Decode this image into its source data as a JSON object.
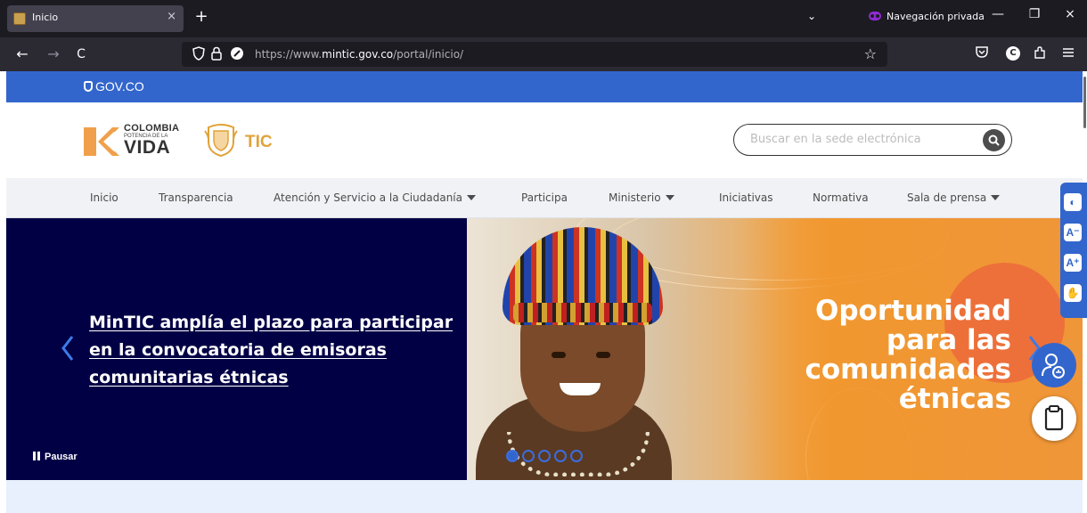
{
  "browser": {
    "tab_title": "Inicio",
    "tab_close": "×",
    "new_tab": "+",
    "list_tabs": "⌄",
    "private_label": "Navegación privada",
    "win_min": "—",
    "win_restore": "❐",
    "win_close": "×",
    "back": "←",
    "forward": "→",
    "reload": "C",
    "url_prefix": "https://www.",
    "url_domain": "mintic.gov.co",
    "url_path": "/portal/inicio/",
    "star": "☆",
    "profile_initial": "C"
  },
  "gov_bar": {
    "logo_text": "GOV.CO"
  },
  "header": {
    "brand_line1": "COLOMBIA",
    "brand_line2": "POTENCIA DE LA",
    "brand_line3": "VIDA",
    "tic_text": "TIC",
    "search_placeholder": "Buscar en la sede electrónica"
  },
  "menu": {
    "items": [
      {
        "label": "Inicio",
        "dropdown": false
      },
      {
        "label": "Transparencia",
        "dropdown": false
      },
      {
        "label": "Atención y Servicio a la Ciudadanía",
        "dropdown": true
      },
      {
        "label": "Participa",
        "dropdown": false
      },
      {
        "label": "Ministerio",
        "dropdown": true
      },
      {
        "label": "Iniciativas",
        "dropdown": false
      },
      {
        "label": "Normativa",
        "dropdown": false
      },
      {
        "label": "Sala de prensa",
        "dropdown": true
      }
    ]
  },
  "hero": {
    "headline": "MinTIC amplía el plazo para participar en la convocatoria de emisoras comunitarias étnicas",
    "pause_label": "Pausar",
    "promo_lines": [
      "Oportunidad",
      "para las",
      "comunidades",
      "étnicas"
    ],
    "slide_count": 5,
    "active_slide": 1
  },
  "accessibility": {
    "buttons": [
      "contrast-icon",
      "decrease-text-icon",
      "increase-text-icon",
      "sign-language-icon"
    ],
    "labels": [
      "◐",
      "A⁻",
      "A⁺",
      "✋"
    ]
  },
  "colors": {
    "gov_blue": "#3366cc",
    "hero_navy": "#020045",
    "orange": "#ef9639"
  }
}
